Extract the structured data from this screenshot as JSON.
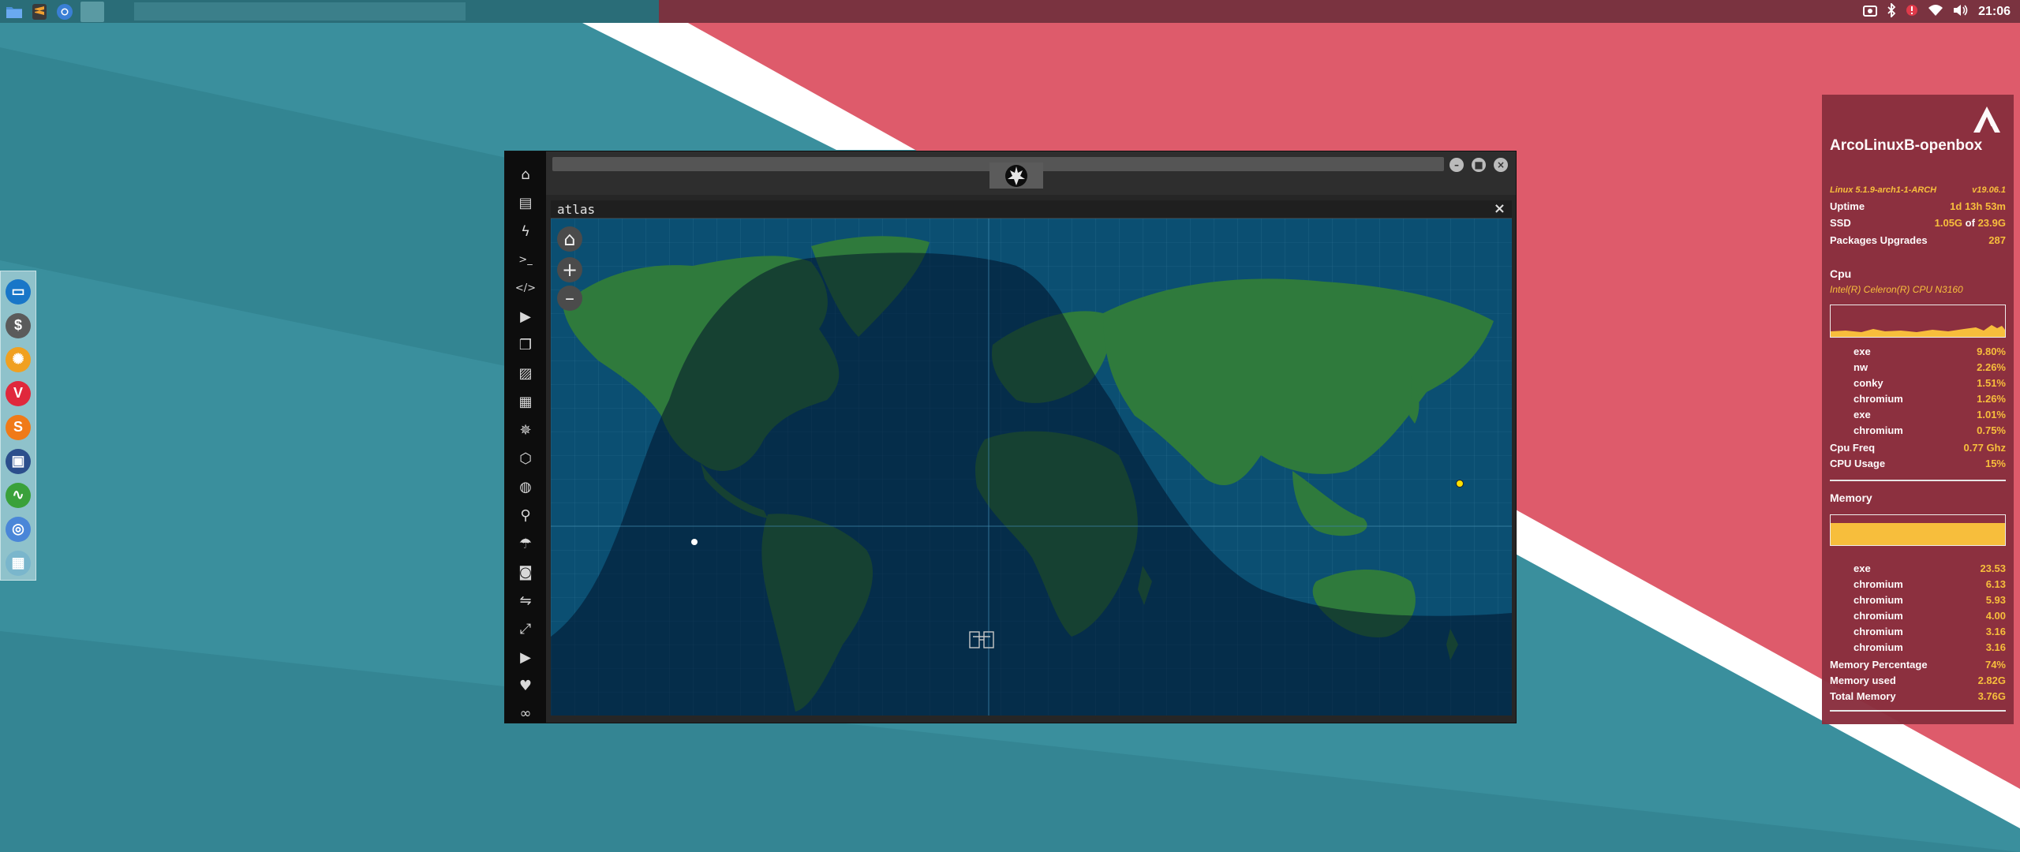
{
  "desktop": {
    "colors": {
      "teal": "#3a8f9d",
      "red": "#de5b6b",
      "white": "#ffffff"
    }
  },
  "top_panel": {
    "launchers": [
      {
        "icon": "folder-icon",
        "color": "#4a90d9"
      },
      {
        "icon": "sublime-text-icon",
        "color": "#f0a030"
      },
      {
        "icon": "chromium-icon",
        "color": "#3a7fd5"
      },
      {
        "icon": "window-slot-icon",
        "color": "#5a9aa3"
      }
    ],
    "tray_icons": [
      "screenshot-icon",
      "bluetooth-icon",
      "system-alert-icon",
      "wifi-icon",
      "volume-icon"
    ],
    "clock": "21:06"
  },
  "dock": {
    "items": [
      {
        "icon": "file-manager-icon",
        "color": "#1976c8",
        "glyph": "▭"
      },
      {
        "icon": "money-icon",
        "color": "#5b5b5b",
        "glyph": "$"
      },
      {
        "icon": "settings-icon",
        "color": "#f0a020",
        "glyph": "✺"
      },
      {
        "icon": "vivaldi-icon",
        "color": "#e0283c",
        "glyph": "V"
      },
      {
        "icon": "sublime-icon",
        "color": "#f07a18",
        "glyph": "S"
      },
      {
        "icon": "screenshot-tool-icon",
        "color": "#2c4f8c",
        "glyph": "▣"
      },
      {
        "icon": "system-monitor-icon",
        "color": "#3aa13a",
        "glyph": "∿"
      },
      {
        "icon": "chromium-icon",
        "color": "#4a86d8",
        "glyph": "◎"
      },
      {
        "icon": "globe-icon",
        "color": "#7ab6cc",
        "glyph": "▦"
      }
    ]
  },
  "app": {
    "sidebar_icons": [
      {
        "name": "home-icon",
        "glyph": "⌂"
      },
      {
        "name": "document-icon",
        "glyph": "▤"
      },
      {
        "name": "lightning-icon",
        "glyph": "ϟ"
      },
      {
        "name": "terminal-icon",
        "glyph": ">_"
      },
      {
        "name": "code-icon",
        "glyph": "</>"
      },
      {
        "name": "play-icon",
        "glyph": "▶"
      },
      {
        "name": "copy-icon",
        "glyph": "❐"
      },
      {
        "name": "image-icon",
        "glyph": "▨"
      },
      {
        "name": "news-icon",
        "glyph": "▦"
      },
      {
        "name": "empire-icon",
        "glyph": "✵"
      },
      {
        "name": "hexagon-icon",
        "glyph": "⬡"
      },
      {
        "name": "globe-icon",
        "glyph": "◍"
      },
      {
        "name": "search-icon",
        "glyph": "⚲"
      },
      {
        "name": "umbrella-icon",
        "glyph": "☂"
      },
      {
        "name": "contact-icon",
        "glyph": "◙"
      },
      {
        "name": "handshake-icon",
        "glyph": "⇋"
      },
      {
        "name": "expand-icon",
        "glyph": "⤢"
      },
      {
        "name": "youtube-icon",
        "glyph": "▶"
      },
      {
        "name": "heart-icon",
        "glyph": "♥"
      },
      {
        "name": "infinity-icon",
        "glyph": "∞"
      }
    ],
    "panel_title": "atlas",
    "close_glyph": "×",
    "map_buttons": {
      "home": "⌂",
      "zoom_in": "+",
      "zoom_out": "–"
    }
  },
  "conky": {
    "hostname": "ArcoLinuxB-openbox",
    "kernel": "Linux 5.1.9-arch1-1-ARCH",
    "version": "v19.06.1",
    "uptime_label": "Uptime",
    "uptime": "1d 13h 53m",
    "ssd_label": "SSD",
    "ssd_used": "1.05G",
    "ssd_of": "of",
    "ssd_total": "23.9G",
    "pkg_label": "Packages Upgrades",
    "pkg_value": "287",
    "cpu_head": "Cpu",
    "cpu_model": "Intel(R) Celeron(R) CPU  N3160",
    "cpu_procs": [
      {
        "name": "exe",
        "value": "9.80%"
      },
      {
        "name": "nw",
        "value": "2.26%"
      },
      {
        "name": "conky",
        "value": "1.51%"
      },
      {
        "name": "chromium",
        "value": "1.26%"
      },
      {
        "name": "exe",
        "value": "1.01%"
      },
      {
        "name": "chromium",
        "value": "0.75%"
      }
    ],
    "cpu_freq_label": "Cpu Freq",
    "cpu_freq": "0.77 Ghz",
    "cpu_usage_label": "CPU Usage",
    "cpu_usage": "15%",
    "mem_head": "Memory",
    "mem_procs": [
      {
        "name": "exe",
        "value": "23.53"
      },
      {
        "name": "chromium",
        "value": "6.13"
      },
      {
        "name": "chromium",
        "value": "5.93"
      },
      {
        "name": "chromium",
        "value": "4.00"
      },
      {
        "name": "chromium",
        "value": "3.16"
      },
      {
        "name": "chromium",
        "value": "3.16"
      }
    ],
    "mem_pct_label": "Memory Percentage",
    "mem_pct": "74%",
    "mem_used_label": "Memory used",
    "mem_used": "2.82G",
    "mem_total_label": "Total Memory",
    "mem_total": "3.76G",
    "mem_fraction": 0.74
  }
}
